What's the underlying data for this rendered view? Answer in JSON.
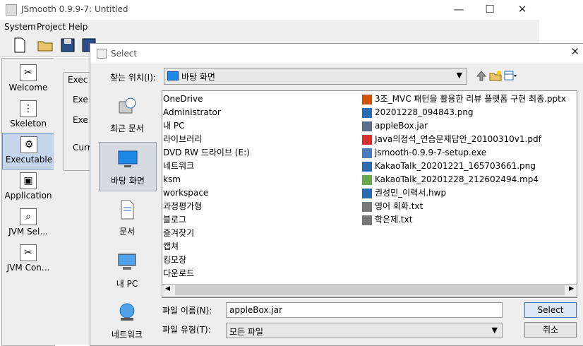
{
  "main_window": {
    "title": "JSmooth 0.9.9-7: Untitled",
    "controls": {
      "minimize": "—",
      "maximize": "☐",
      "close": "✕"
    },
    "menu": [
      "System",
      "Project",
      "Help"
    ],
    "sidebar": [
      {
        "label": "Welcome",
        "icon": "welcome-icon"
      },
      {
        "label": "Skeleton",
        "icon": "skeleton-icon"
      },
      {
        "label": "Executable",
        "icon": "executable-icon"
      },
      {
        "label": "Application",
        "icon": "application-icon"
      },
      {
        "label": "JVM Sel...",
        "icon": "jvm-selection-icon"
      },
      {
        "label": "JVM Con...",
        "icon": "jvm-configuration-icon"
      }
    ],
    "sidebar_selected": "Executable",
    "content_labels": [
      "Exec",
      "Exe",
      "Exe",
      "Curr"
    ]
  },
  "dialog": {
    "title": "Select",
    "close": "✕",
    "look_in_label": "찾는 위치(I):",
    "look_in_value": "바탕 화면",
    "places": [
      "최근 문서",
      "바탕 화면",
      "문서",
      "내 PC",
      "네트워크"
    ],
    "places_selected": "바탕 화면",
    "files_col1": [
      {
        "name": "OneDrive",
        "icon": "none"
      },
      {
        "name": "Administrator",
        "icon": "none"
      },
      {
        "name": "내 PC",
        "icon": "none"
      },
      {
        "name": "라이브러리",
        "icon": "none"
      },
      {
        "name": "DVD RW 드라이브 (E:)",
        "icon": "none"
      },
      {
        "name": "네트워크",
        "icon": "none"
      },
      {
        "name": "ksm",
        "icon": "none"
      },
      {
        "name": "workspace",
        "icon": "none"
      },
      {
        "name": "과정평가형",
        "icon": "none"
      },
      {
        "name": "블로그",
        "icon": "none"
      },
      {
        "name": "즐겨찾기",
        "icon": "none"
      },
      {
        "name": "캡쳐",
        "icon": "none"
      },
      {
        "name": "킹모장",
        "icon": "none"
      },
      {
        "name": "다운로드",
        "icon": "none"
      }
    ],
    "files_col2": [
      {
        "name": "3조_MVC 패턴을 활용한 리뷰 플랫폼 구현 최종.pptx",
        "icon": "pptx-icon",
        "color": "#d35400"
      },
      {
        "name": "20201228_094843.png",
        "icon": "png-icon",
        "color": "#2b6cb0"
      },
      {
        "name": "appleBox.jar",
        "icon": "jar-icon",
        "color": "#5a6f8a"
      },
      {
        "name": "Java의정석_연습문제답안_20100310v1.pdf",
        "icon": "pdf-icon",
        "color": "#d32f2f"
      },
      {
        "name": "jsmooth-0.9.9-7-setup.exe",
        "icon": "exe-icon",
        "color": "#4a7bbf"
      },
      {
        "name": "KakaoTalk_20201221_165703661.png",
        "icon": "png-icon",
        "color": "#2b6cb0"
      },
      {
        "name": "KakaoTalk_20201228_212602494.mp4",
        "icon": "mp4-icon",
        "color": "#6aa84f"
      },
      {
        "name": "권성민_이력서.hwp",
        "icon": "hwp-icon",
        "color": "#2b6cb0"
      },
      {
        "name": "영어 회화.txt",
        "icon": "txt-icon",
        "color": "#777777"
      },
      {
        "name": "학은제.txt",
        "icon": "txt-icon",
        "color": "#777777"
      }
    ],
    "file_name_label": "파일 이름(N):",
    "file_name_value": "appleBox.jar",
    "file_type_label": "파일 유형(T):",
    "file_type_value": "모든 파일",
    "select_button": "Select",
    "cancel_button": "취소"
  }
}
